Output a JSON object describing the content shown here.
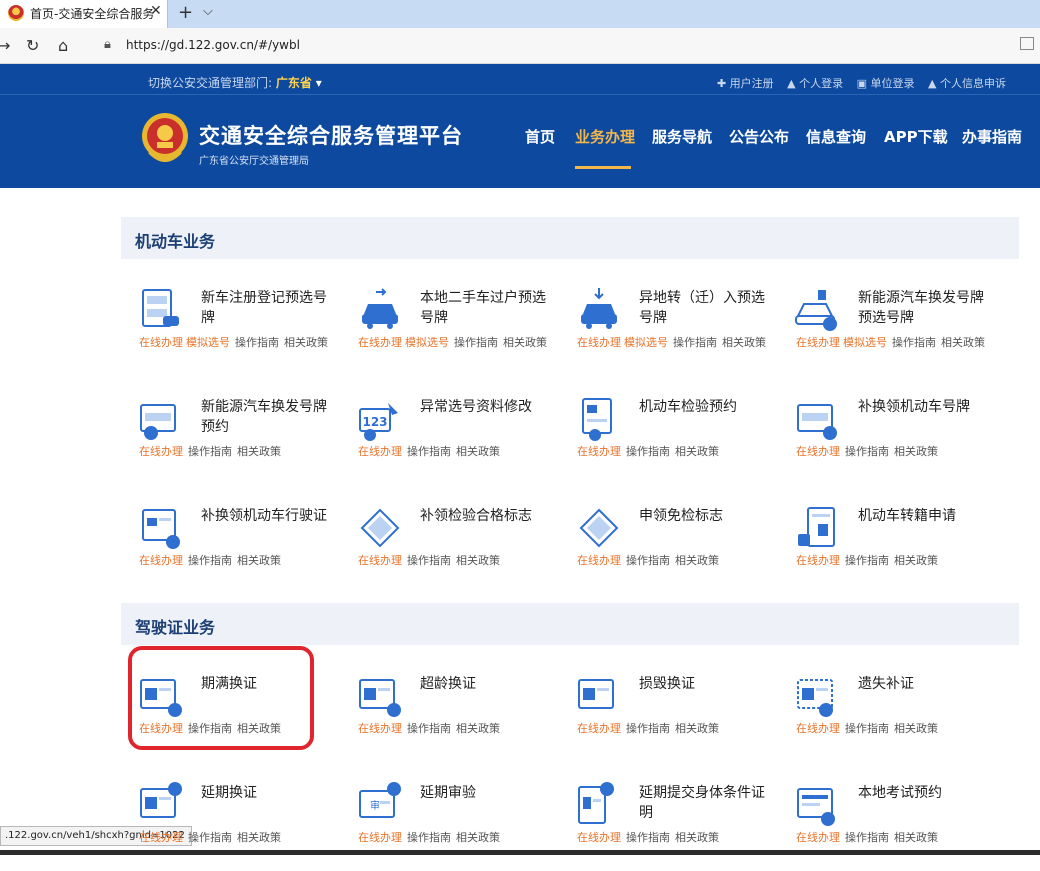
{
  "browser": {
    "tab_title": "首页-交通安全综合服务",
    "tab_close": "✕",
    "new_tab": "+",
    "tab_dropdown": "⌵",
    "url": "https://gd.122.gov.cn/#/ywbl",
    "status_url": ".122.gov.cn/veh1/shcxh?gnid=1022"
  },
  "header": {
    "region_prefix": "切换公安交通管理部门:",
    "region_value": "广东省",
    "region_caret": "▾",
    "top_links": [
      "✚ 用户注册",
      "▲ 个人登录",
      "▣ 单位登录",
      "▲ 个人信息申诉"
    ],
    "site_title": "交通安全综合服务管理平台",
    "site_subtitle": "广东省公安厅交通管理局",
    "nav": [
      "首页",
      "业务办理",
      "服务导航",
      "公告公布",
      "信息查询",
      "APP下载",
      "办事指南"
    ],
    "nav_active_index": 1
  },
  "sections": {
    "vehicle": "机动车业务",
    "license": "驾驶证业务"
  },
  "link_labels": {
    "online": "在线办理",
    "simulate": "模拟选号",
    "guide": "操作指南",
    "policy": "相关政策"
  },
  "vehicle_items": [
    {
      "name": "新车注册登记预选号牌",
      "has_simulate": true,
      "icon": "new-car-plate-icon"
    },
    {
      "name": "本地二手车过户预选号牌",
      "has_simulate": true,
      "icon": "used-car-transfer-icon"
    },
    {
      "name": "异地转（迁）入预选号牌",
      "has_simulate": true,
      "icon": "car-transfer-in-icon"
    },
    {
      "name": "新能源汽车换发号牌预选号牌",
      "has_simulate": true,
      "icon": "ev-car-plate-icon"
    },
    {
      "name": "新能源汽车换发号牌预约",
      "has_simulate": false,
      "icon": "ev-plate-reserve-icon"
    },
    {
      "name": "异常选号资料修改",
      "has_simulate": false,
      "icon": "plate-123-edit-icon"
    },
    {
      "name": "机动车检验预约",
      "has_simulate": false,
      "icon": "inspection-reserve-icon"
    },
    {
      "name": "补换领机动车号牌",
      "has_simulate": false,
      "icon": "plate-replace-icon"
    },
    {
      "name": "补换领机动车行驶证",
      "has_simulate": false,
      "icon": "driving-permit-replace-icon"
    },
    {
      "name": "补领检验合格标志",
      "has_simulate": false,
      "icon": "inspection-mark-icon"
    },
    {
      "name": "申领免检标志",
      "has_simulate": false,
      "icon": "exempt-mark-icon"
    },
    {
      "name": "机动车转籍申请",
      "has_simulate": false,
      "icon": "vehicle-transfer-icon"
    }
  ],
  "license_items": [
    {
      "name": "期满换证",
      "icon": "license-expire-renew-icon"
    },
    {
      "name": "超龄换证",
      "icon": "license-age-renew-icon"
    },
    {
      "name": "损毁换证",
      "icon": "license-damage-renew-icon"
    },
    {
      "name": "遗失补证",
      "icon": "license-lost-reissue-icon"
    },
    {
      "name": "延期换证",
      "icon": "license-defer-renew-icon"
    },
    {
      "name": "延期审验",
      "icon": "license-defer-review-icon"
    },
    {
      "name": "延期提交身体条件证明",
      "icon": "health-proof-defer-icon"
    },
    {
      "name": "本地考试预约",
      "icon": "exam-reserve-icon"
    }
  ],
  "colors": {
    "header_blue": "#0d4a9f",
    "active_nav": "#f2b64a",
    "orange_link": "#e8732b",
    "icon_blue": "#2f6fd0",
    "highlight_red": "#e0262c"
  }
}
